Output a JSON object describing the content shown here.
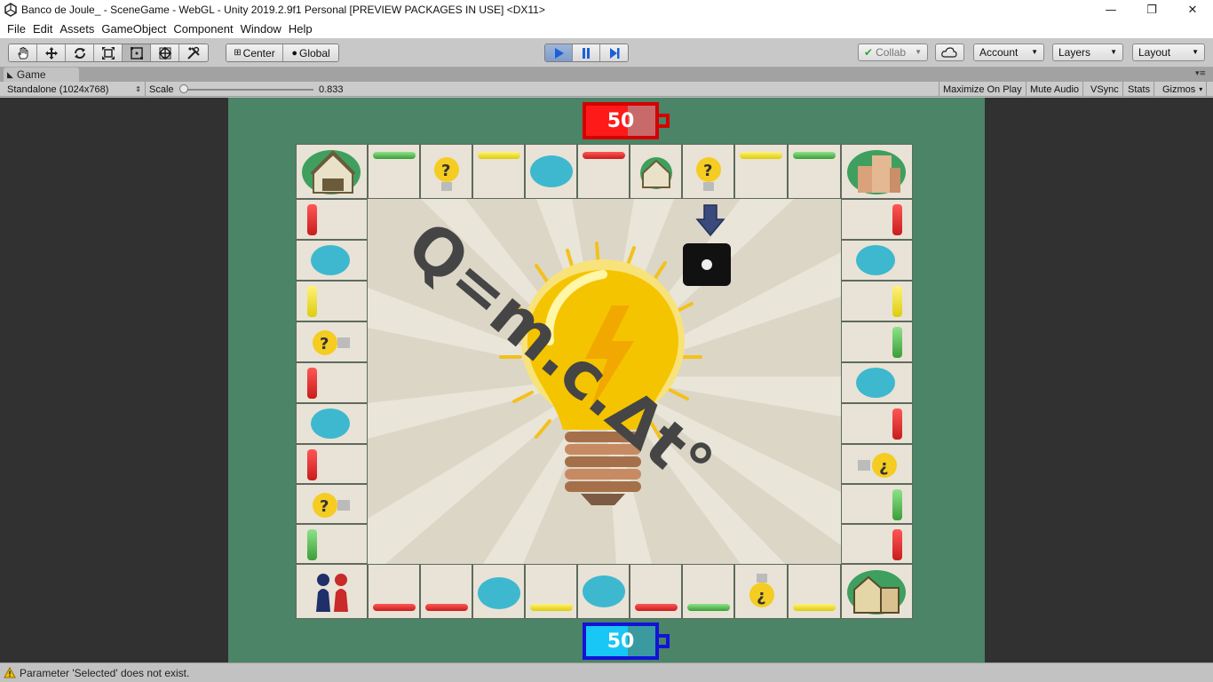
{
  "window": {
    "title": "Banco de Joule_ - SceneGame - WebGL - Unity 2019.2.9f1 Personal [PREVIEW PACKAGES IN USE] <DX11>",
    "controls": [
      "—",
      "❐",
      "✕"
    ]
  },
  "menu": [
    "File",
    "Edit",
    "Assets",
    "GameObject",
    "Component",
    "Window",
    "Help"
  ],
  "toolbar": {
    "pivot": "Center",
    "space": "Global",
    "collab": "Collab",
    "account": "Account",
    "layers": "Layers",
    "layout": "Layout"
  },
  "game_tab": {
    "label": "Game",
    "resolution": "Standalone (1024x768)",
    "scale_label": "Scale",
    "scale_value": "0.833",
    "scale_fraction": 0.0,
    "options": [
      "Maximize On Play",
      "Mute Audio",
      "VSync",
      "Stats",
      "Gizmos"
    ]
  },
  "game": {
    "top_battery": {
      "value": "50",
      "color": "#e80000"
    },
    "bottom_battery": {
      "value": "50",
      "color": "#19c7f2"
    },
    "formula": "Q=m.c.Δt°"
  },
  "status": {
    "message": "Parameter 'Selected' does not exist."
  }
}
